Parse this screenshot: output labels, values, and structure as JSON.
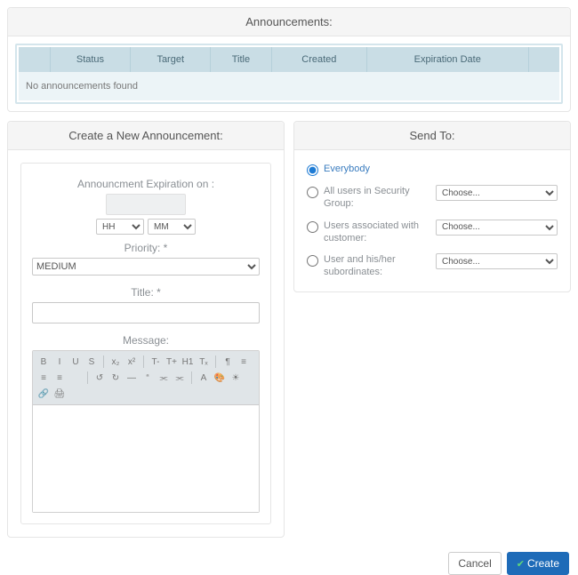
{
  "page_title": "Announcements:",
  "table": {
    "headers": [
      "Status",
      "Target",
      "Title",
      "Created",
      "Expiration Date"
    ],
    "empty_message": "No announcements found"
  },
  "create_form": {
    "title": "Create a New Announcement:",
    "expiration_label": "Announcment Expiration on :",
    "time_hh": "HH",
    "time_mm": "MM",
    "priority_label": "Priority: *",
    "priority_value": "MEDIUM",
    "title_field_label": "Title: *",
    "message_label": "Message:"
  },
  "send_to": {
    "title": "Send To:",
    "choose_placeholder": "Choose...",
    "options": {
      "everybody": "Everybody",
      "security_group": "All users in Security Group:",
      "customer": "Users associated with customer:",
      "subordinates": "User and his/her subordinates:"
    }
  },
  "buttons": {
    "cancel": "Cancel",
    "create": "Create"
  },
  "toolbar_icons": [
    "B",
    "I",
    "U",
    "S",
    "x₂",
    "x²",
    "T-",
    "T+",
    "H1",
    "Tₓ",
    "¶",
    "≡",
    "≡",
    "≡",
    "",
    "↺",
    "↻",
    "—",
    "“",
    "⫘",
    "⫘",
    "A",
    "🎨",
    "☀",
    "🔗",
    "🖨"
  ]
}
